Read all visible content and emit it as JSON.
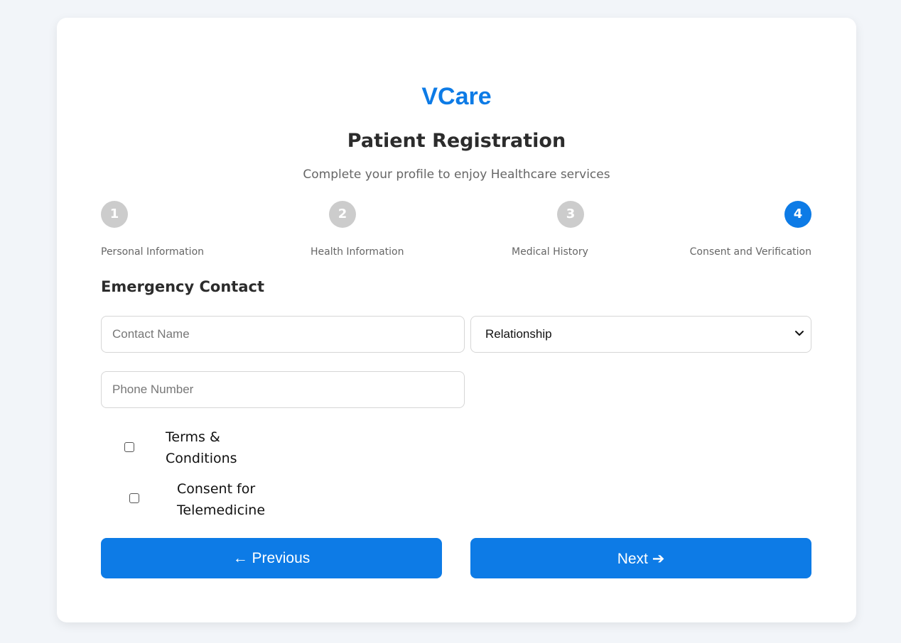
{
  "brand": "VCare",
  "title": "Patient Registration",
  "subtitle": "Complete your profile to enjoy Healthcare services",
  "steps": [
    {
      "number": "1",
      "label": "Personal Information",
      "active": false
    },
    {
      "number": "2",
      "label": "Health Information",
      "active": false
    },
    {
      "number": "3",
      "label": "Medical History",
      "active": false
    },
    {
      "number": "4",
      "label": "Consent and Verification",
      "active": true
    }
  ],
  "section_title": "Emergency Contact",
  "form": {
    "contact_name_placeholder": "Contact Name",
    "contact_name_value": "",
    "relationship_selected": "Relationship",
    "phone_placeholder": "Phone Number",
    "phone_value": "",
    "terms_line1": "Terms &",
    "terms_line2": "Conditions",
    "terms_checked": false,
    "consent_line1": "Consent for",
    "consent_line2": "Telemedicine",
    "consent_checked": false
  },
  "buttons": {
    "previous": "← Previous",
    "next": "Next ➔"
  },
  "colors": {
    "accent": "#0d7be6",
    "inactive_step": "#cccccc",
    "background": "#f2f5f9"
  },
  "icons": {
    "select_arrow": "chevron-down-icon"
  }
}
